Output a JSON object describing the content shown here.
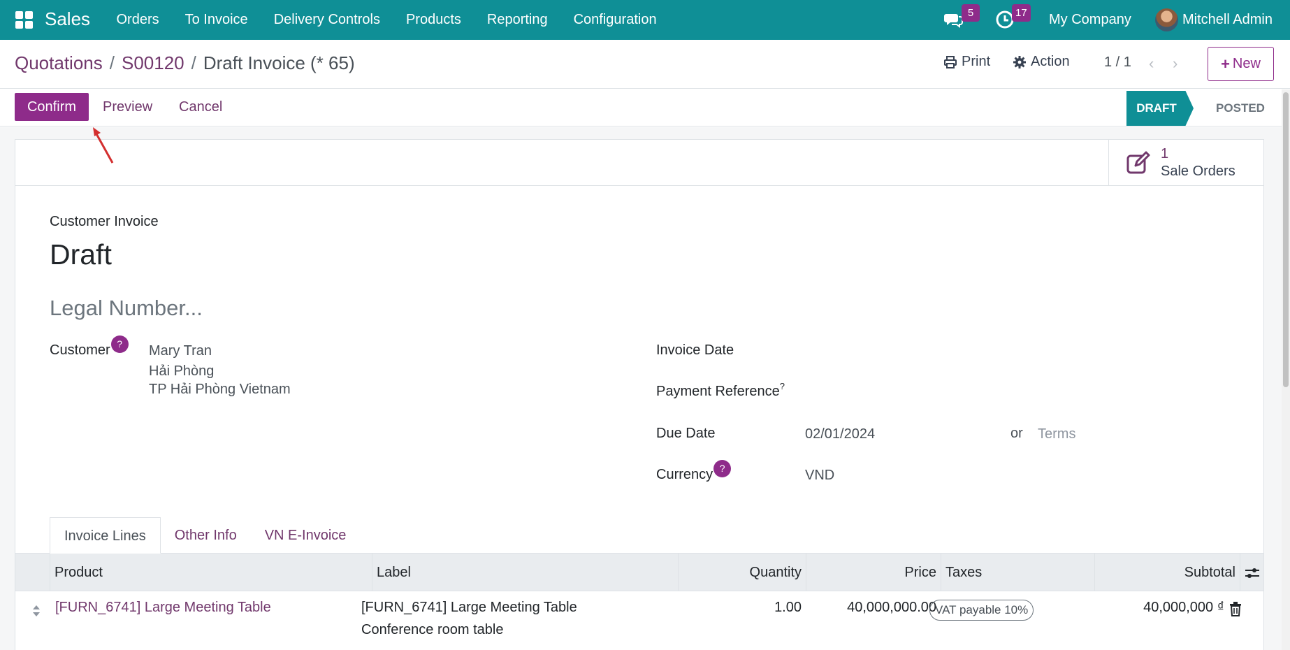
{
  "navbar": {
    "app_name": "Sales",
    "menu": [
      "Orders",
      "To Invoice",
      "Delivery Controls",
      "Products",
      "Reporting",
      "Configuration"
    ],
    "messages_count": "5",
    "activities_count": "17",
    "company": "My Company",
    "user": "Mitchell Admin"
  },
  "control_panel": {
    "breadcrumb": [
      "Quotations",
      "S00120",
      "Draft Invoice (* 65)"
    ],
    "print_label": "Print",
    "action_label": "Action",
    "pager": "1 / 1",
    "new_label": "New"
  },
  "status_bar": {
    "buttons": {
      "confirm": "Confirm",
      "preview": "Preview",
      "cancel": "Cancel"
    },
    "stages": [
      "DRAFT",
      "POSTED"
    ],
    "current_stage": "DRAFT"
  },
  "smart_button": {
    "count": "1",
    "label": "Sale Orders"
  },
  "invoice": {
    "type": "Customer Invoice",
    "name": "Draft",
    "legal_number_placeholder": "Legal Number...",
    "customer": {
      "label": "Customer",
      "help": "?",
      "name": "Mary Tran",
      "address_line1": "Hải Phòng",
      "address_line2": "TP Hải Phòng Vietnam"
    },
    "invoice_date": {
      "label": "Invoice Date",
      "value": ""
    },
    "payment_reference": {
      "label": "Payment Reference",
      "help": "?",
      "value": ""
    },
    "due_date": {
      "label": "Due Date",
      "value": "02/01/2024",
      "or": "or",
      "terms_placeholder": "Terms"
    },
    "currency": {
      "label": "Currency",
      "help": "?",
      "value": "VND"
    }
  },
  "tabs": [
    "Invoice Lines",
    "Other Info",
    "VN E-Invoice"
  ],
  "active_tab": "Invoice Lines",
  "invoice_lines": {
    "columns": [
      "Product",
      "Label",
      "Quantity",
      "Price",
      "Taxes",
      "Subtotal"
    ],
    "rows": [
      {
        "product": "[FURN_6741] Large Meeting Table",
        "label_line1": "[FURN_6741] Large Meeting Table",
        "label_line2": "Conference room table",
        "quantity": "1.00",
        "price": "40,000,000.00",
        "tax": "VAT payable 10%",
        "subtotal": "40,000,000 ₫"
      }
    ]
  },
  "colors": {
    "navbar": "#0f8f96",
    "primary": "#8e2b8a",
    "link": "#71386c",
    "stage_active": "#0f8f96",
    "annotation_arrow": "#d32f2f"
  },
  "icons": [
    "apps-grid-icon",
    "chat-icon",
    "clock-icon",
    "print-icon",
    "gear-icon",
    "chevron-left-icon",
    "chevron-right-icon",
    "plus-icon",
    "edit-square-icon",
    "drag-handle-icon",
    "column-settings-icon",
    "trash-icon"
  ]
}
